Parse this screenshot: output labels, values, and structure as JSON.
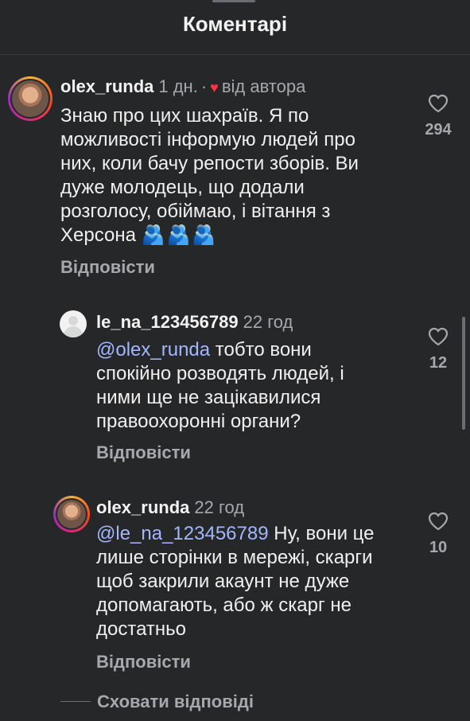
{
  "header": {
    "title": "Коментарі"
  },
  "comments": [
    {
      "username": "olex_runda",
      "time": "1 дн.",
      "by_author": "від автора",
      "text": "Знаю про цих шахраїв. Я по можливості інформую людей про них, коли бачу репости зборів. Ви дуже молодець, що додали розголосу, обіймаю, і вітання з Херсона",
      "emoji": "🫂🫂🫂",
      "reply_label": "Відповісти",
      "likes": "294"
    },
    {
      "username": "le_na_123456789",
      "time": "22 год",
      "mention": "@olex_runda",
      "text": "тобто вони спокійно розводять людей, і ними ще не зацікавилися правоохоронні органи?",
      "reply_label": "Відповісти",
      "likes": "12"
    },
    {
      "username": "olex_runda",
      "time": "22 год",
      "mention": "@le_na_123456789",
      "text": "Ну, вони це лише сторінки в мережі, скарги щоб закрили акаунт не дуже допомагають, або ж скарг не достатньо",
      "reply_label": "Відповісти",
      "likes": "10"
    }
  ],
  "hide_replies_label": "Сховати відповіді",
  "icons": {
    "heart_outline": "heart-outline-icon",
    "heart_filled": "heart-filled-icon"
  },
  "colors": {
    "background": "#262729",
    "mention": "#a3b7ff",
    "heart_red": "#ff3040",
    "muted_text": "#a6a8ad"
  }
}
